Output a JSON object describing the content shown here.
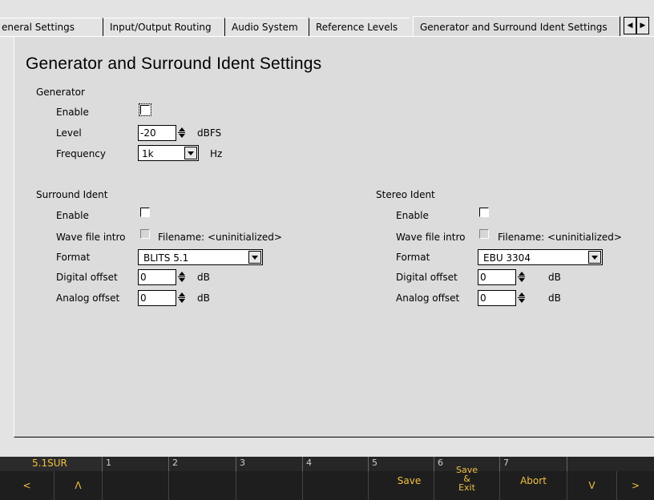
{
  "tabs": [
    {
      "label": "eneral Settings"
    },
    {
      "label": "Input/Output Routing"
    },
    {
      "label": "Audio System"
    },
    {
      "label": "Reference Levels"
    },
    {
      "label": "Generator and Surround Ident Settings"
    }
  ],
  "page_title": "Generator and Surround Ident Settings",
  "generator": {
    "heading": "Generator",
    "enable_label": "Enable",
    "enable_checked": false,
    "level_label": "Level",
    "level_value": "-20",
    "level_unit": "dBFS",
    "frequency_label": "Frequency",
    "frequency_value": "1k",
    "frequency_unit": "Hz"
  },
  "surround": {
    "heading": "Surround Ident",
    "enable_label": "Enable",
    "enable_checked": false,
    "wave_label": "Wave file intro",
    "wave_checked": false,
    "filename_text": "Filename: <uninitialized>",
    "format_label": "Format",
    "format_value": "BLITS 5.1",
    "digital_label": "Digital offset",
    "digital_value": "0",
    "digital_unit": "dB",
    "analog_label": "Analog offset",
    "analog_value": "0",
    "analog_unit": "dB"
  },
  "stereo": {
    "heading": "Stereo Ident",
    "enable_label": "Enable",
    "enable_checked": false,
    "wave_label": "Wave file intro",
    "wave_checked": false,
    "filename_text": "Filename: <uninitialized>",
    "format_label": "Format",
    "format_value": "EBU 3304",
    "digital_label": "Digital offset",
    "digital_value": "0",
    "digital_unit": "dB",
    "analog_label": "Analog offset",
    "analog_value": "0",
    "analog_unit": "dB"
  },
  "softbar": {
    "preset": "5.1SUR",
    "numbers": [
      "1",
      "2",
      "3",
      "4",
      "5",
      "6",
      "7"
    ],
    "keys": {
      "left": "<",
      "up": "Λ",
      "save": "Save",
      "save_exit_1": "Save",
      "save_exit_2": "&",
      "save_exit_3": "Exit",
      "abort": "Abort",
      "down": "V",
      "right": ">"
    }
  },
  "colors": {
    "background": "#e3e3e3",
    "panel": "#dcdcdc",
    "softkey_bar": "#1e1e1e",
    "softkey_text": "#f0c040"
  }
}
